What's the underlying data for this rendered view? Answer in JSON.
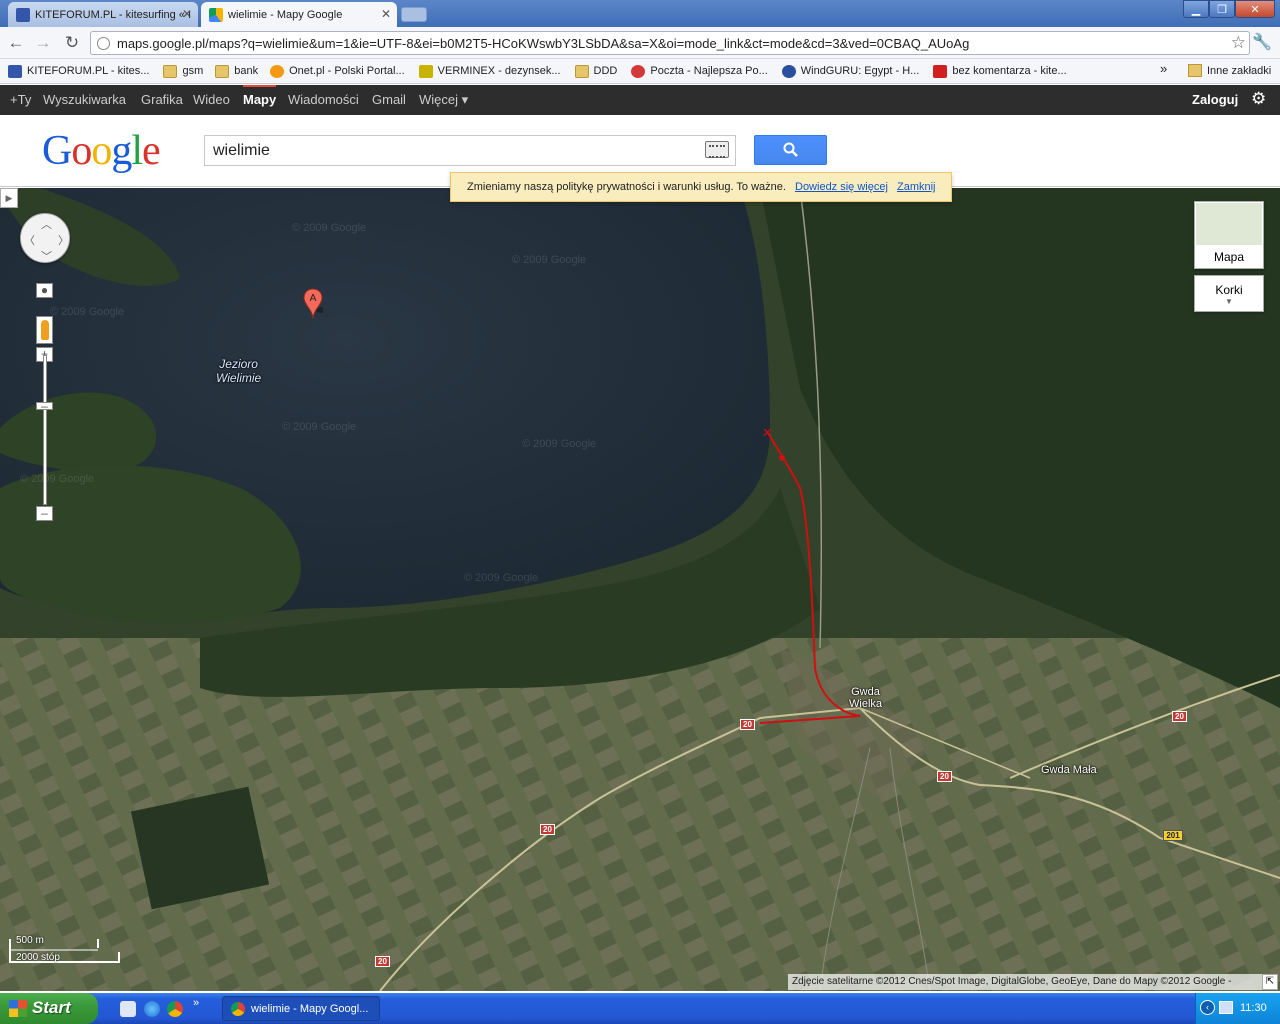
{
  "browser": {
    "tabs": [
      {
        "title": "KITEFORUM.PL - kitesurfing « I"
      },
      {
        "title": "wielimie - Mapy Google"
      }
    ],
    "address": "maps.google.pl/maps?q=wielimie&um=1&ie=UTF-8&ei=b0M2T5-HCoKWswbY3LSbDA&sa=X&oi=mode_link&ct=mode&cd=3&ved=0CBAQ_AUoAg",
    "bookmarks": [
      {
        "label": "KITEFORUM.PL - kites...",
        "icon": "kite-icon",
        "color": "#3355aa"
      },
      {
        "label": "gsm",
        "icon": "folder-icon",
        "color": "#e6c56b"
      },
      {
        "label": "bank",
        "icon": "folder-icon",
        "color": "#e6c56b"
      },
      {
        "label": "Onet.pl - Polski Portal...",
        "icon": "onet-icon",
        "color": "#f39a12"
      },
      {
        "label": "VERMINEX - dezynsek...",
        "icon": "verminex-icon",
        "color": "#c8b400"
      },
      {
        "label": "DDD",
        "icon": "folder-icon",
        "color": "#e6c56b"
      },
      {
        "label": "Poczta - Najlepsza Po...",
        "icon": "mail-icon",
        "color": "#d23a3a"
      },
      {
        "label": "WindGURU: Egypt - H...",
        "icon": "windguru-icon",
        "color": "#2a4fa0"
      },
      {
        "label": "bez komentarza - kite...",
        "icon": "youtube-icon",
        "color": "#d21f1f"
      }
    ],
    "bookmarks_more": "»",
    "other_bookmarks": "Inne zakładki",
    "window_controls": {
      "minimize": "▁",
      "maximize": "❐",
      "close": "✕"
    }
  },
  "gbar": {
    "items": [
      "+Ty",
      "Wyszukiwarka",
      "Grafika",
      "Wideo",
      "Mapy",
      "Wiadomości",
      "Gmail",
      "Więcej ▾"
    ],
    "active": "Mapy",
    "signin": "Zaloguj"
  },
  "search": {
    "logo": [
      "G",
      "o",
      "o",
      "g",
      "l",
      "e"
    ],
    "logo_colors": [
      "#1a5cd7",
      "#d8322a",
      "#f0b400",
      "#1a5cd7",
      "#21a141",
      "#d8322a"
    ],
    "query": "wielimie"
  },
  "notice": {
    "text": "Zmieniamy naszą politykę prywatności i warunki usług. To ważne.",
    "learn_more": "Dowiedz się więcej",
    "close": "Zamknij"
  },
  "map": {
    "marker": "A",
    "lake_label": [
      "Jezioro",
      "Wielimie"
    ],
    "towns": [
      {
        "name": "Gwda Wielka",
        "lines": [
          "Gwda",
          "Wielka"
        ]
      },
      {
        "name": "Gwda Mała",
        "lines": [
          "Gwda Mała"
        ]
      }
    ],
    "road_shields": [
      "20",
      "20",
      "20",
      "20",
      "20",
      "201"
    ],
    "watermarks": [
      "© 2009 Google",
      "© 2009 Google",
      "© 2009 Google",
      "© 2009 Google",
      "© 2009 Google",
      "© 2009 Google",
      "© 2009 Google"
    ],
    "map_type": "Mapa",
    "traffic": "Korki",
    "scale_metric": "500 m",
    "scale_imperial": "2000 stóp",
    "copyright": "Zdjęcie satelitarne ©2012 Cnes/Spot Image, DigitalGlobe, GeoEye, Dane do Mapy ©2012 Google -"
  },
  "taskbar": {
    "start": "Start",
    "quick_launch": [
      "quicklaunch-icon",
      "ie-icon",
      "chrome-icon"
    ],
    "quick_more": "»",
    "window": "wielimie - Mapy Googl...",
    "clock": "11:30"
  }
}
